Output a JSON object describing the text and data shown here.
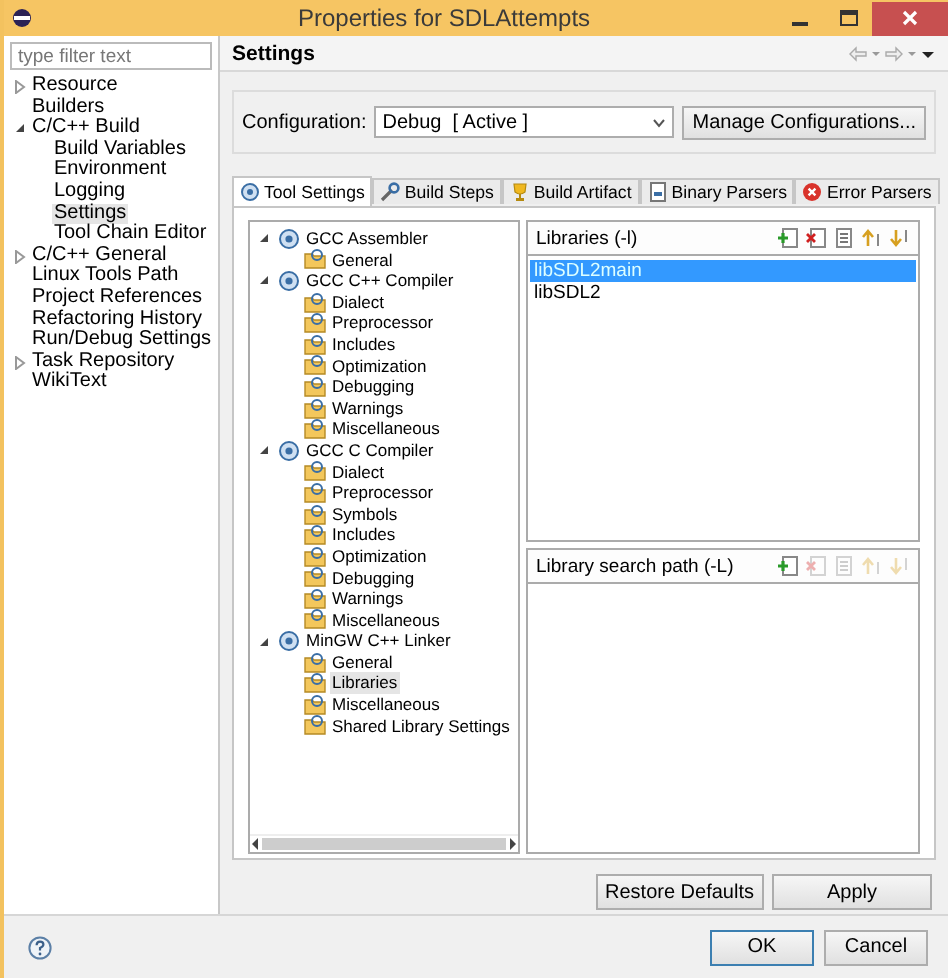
{
  "window": {
    "title": "Properties for SDLAttempts"
  },
  "filter": {
    "placeholder": "type filter text"
  },
  "sidebar": {
    "items": [
      {
        "label": "Resource",
        "expanded": false,
        "selected": false
      },
      {
        "label": "Builders",
        "selected": false
      },
      {
        "label": "C/C++ Build",
        "expanded": true,
        "selected": false,
        "children": [
          {
            "label": "Build Variables",
            "selected": false
          },
          {
            "label": "Environment",
            "selected": false
          },
          {
            "label": "Logging",
            "selected": false
          },
          {
            "label": "Settings",
            "selected": true
          },
          {
            "label": "Tool Chain Editor",
            "selected": false
          }
        ]
      },
      {
        "label": "C/C++ General",
        "expanded": false,
        "selected": false
      },
      {
        "label": "Linux Tools Path",
        "selected": false
      },
      {
        "label": "Project References",
        "selected": false
      },
      {
        "label": "Refactoring History",
        "selected": false
      },
      {
        "label": "Run/Debug Settings",
        "selected": false
      },
      {
        "label": "Task Repository",
        "expanded": false,
        "selected": false
      },
      {
        "label": "WikiText",
        "selected": false
      }
    ]
  },
  "page": {
    "title": "Settings"
  },
  "configuration": {
    "label": "Configuration:",
    "value": "Debug  [ Active ]",
    "button": "Manage Configurations..."
  },
  "tabs": [
    {
      "label": "Tool Settings",
      "kind": "settings",
      "selected": true
    },
    {
      "label": "Build Steps",
      "kind": "steps",
      "selected": false
    },
    {
      "label": "Build Artifact",
      "kind": "artifact",
      "selected": false
    },
    {
      "label": "Binary Parsers",
      "kind": "binary",
      "selected": false
    },
    {
      "label": "Error Parsers",
      "kind": "error",
      "selected": false
    }
  ],
  "tool_tree": [
    {
      "label": "GCC Assembler",
      "kind": "tool",
      "expanded": true,
      "selected": false,
      "children": [
        {
          "label": "General",
          "kind": "category",
          "selected": false
        }
      ]
    },
    {
      "label": "GCC C++ Compiler",
      "kind": "tool",
      "expanded": true,
      "selected": false,
      "children": [
        {
          "label": "Dialect",
          "kind": "category",
          "selected": false
        },
        {
          "label": "Preprocessor",
          "kind": "category",
          "selected": false
        },
        {
          "label": "Includes",
          "kind": "category",
          "selected": false
        },
        {
          "label": "Optimization",
          "kind": "category",
          "selected": false
        },
        {
          "label": "Debugging",
          "kind": "category",
          "selected": false
        },
        {
          "label": "Warnings",
          "kind": "category",
          "selected": false
        },
        {
          "label": "Miscellaneous",
          "kind": "category",
          "selected": false
        }
      ]
    },
    {
      "label": "GCC C Compiler",
      "kind": "tool",
      "expanded": true,
      "selected": false,
      "children": [
        {
          "label": "Dialect",
          "kind": "category",
          "selected": false
        },
        {
          "label": "Preprocessor",
          "kind": "category",
          "selected": false
        },
        {
          "label": "Symbols",
          "kind": "category",
          "selected": false
        },
        {
          "label": "Includes",
          "kind": "category",
          "selected": false
        },
        {
          "label": "Optimization",
          "kind": "category",
          "selected": false
        },
        {
          "label": "Debugging",
          "kind": "category",
          "selected": false
        },
        {
          "label": "Warnings",
          "kind": "category",
          "selected": false
        },
        {
          "label": "Miscellaneous",
          "kind": "category",
          "selected": false
        }
      ]
    },
    {
      "label": "MinGW C++ Linker",
      "kind": "tool",
      "expanded": true,
      "selected": false,
      "children": [
        {
          "label": "General",
          "kind": "category",
          "selected": false
        },
        {
          "label": "Libraries",
          "kind": "category",
          "selected": true
        },
        {
          "label": "Miscellaneous",
          "kind": "category",
          "selected": false
        },
        {
          "label": "Shared Library Settings",
          "kind": "category",
          "selected": false
        }
      ]
    }
  ],
  "libraries": {
    "title": "Libraries (-l)",
    "tools": [
      {
        "kind": "add",
        "disabled": false
      },
      {
        "kind": "delete",
        "disabled": false
      },
      {
        "kind": "edit",
        "disabled": false
      },
      {
        "kind": "up",
        "disabled": false
      },
      {
        "kind": "down",
        "disabled": false
      }
    ],
    "items": [
      {
        "label": "libSDL2main",
        "selected": true
      },
      {
        "label": "libSDL2",
        "selected": false
      }
    ]
  },
  "search_path": {
    "title": "Library search path (-L)",
    "tools": [
      {
        "kind": "add",
        "disabled": false
      },
      {
        "kind": "delete",
        "disabled": true
      },
      {
        "kind": "edit",
        "disabled": true
      },
      {
        "kind": "up",
        "disabled": true
      },
      {
        "kind": "down",
        "disabled": true
      }
    ]
  },
  "buttons": [
    "Restore Defaults",
    "Apply"
  ],
  "dialog_buttons": [
    "OK",
    "Cancel"
  ]
}
